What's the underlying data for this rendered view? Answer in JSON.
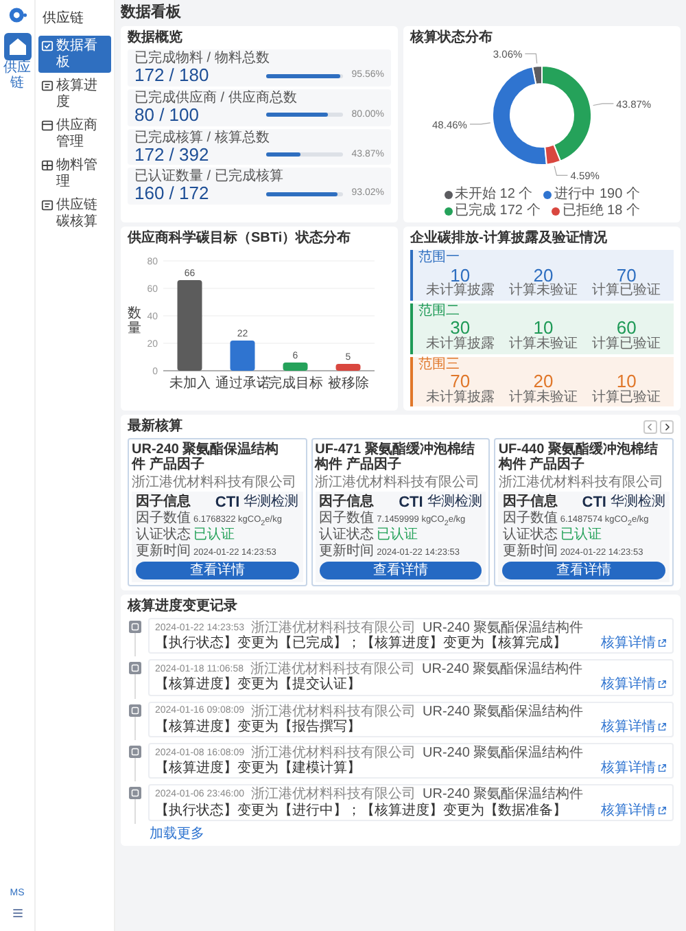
{
  "rail": {
    "items": [
      {
        "label": "供应链",
        "selected": true
      }
    ],
    "user_initials": "MS"
  },
  "sidebar": {
    "title": "供应链",
    "items": [
      {
        "label": "数据看板",
        "selected": true
      },
      {
        "label": "核算进度",
        "selected": false
      },
      {
        "label": "供应商管理",
        "selected": false
      },
      {
        "label": "物料管理",
        "selected": false
      },
      {
        "label": "供应链碳核算",
        "selected": false
      }
    ]
  },
  "page_title": "数据看板",
  "overview": {
    "title": "数据概览",
    "items": [
      {
        "label": "已完成物料 / 物料总数",
        "value": "172 / 180",
        "level": 0.9556,
        "percent": "95.56%"
      },
      {
        "label": "已完成供应商 / 供应商总数",
        "value": "80 / 100",
        "level": 0.8,
        "percent": "80.00%"
      },
      {
        "label": "已完成核算 / 核算总数",
        "value": "172 / 392",
        "level": 0.4387,
        "percent": "43.87%"
      },
      {
        "label": "已认证数量 / 已完成核算",
        "value": "160 / 172",
        "level": 0.9302,
        "percent": "93.02%"
      }
    ]
  },
  "status_chart": {
    "title": "核算状态分布",
    "chart_data": {
      "type": "donut",
      "categories": [
        "未开始",
        "进行中",
        "已完成",
        "已拒绝"
      ],
      "series": [
        {
          "values": [
            3.06,
            48.46,
            43.87,
            4.59
          ]
        }
      ],
      "value_labels": [
        "3.06%",
        "48.46%",
        "43.87%",
        "4.59%"
      ]
    },
    "legend": [
      {
        "count": "12 个",
        "color": "#5c5c60"
      },
      {
        "count": "190 个",
        "color": "#2f74d0"
      },
      {
        "count": "172 个",
        "color": "#25a25a"
      },
      {
        "count": "18 个",
        "color": "#d9473f"
      }
    ]
  },
  "sbti_chart": {
    "chart_data": {
      "type": "bar",
      "title": "供应商科学碳目标（SBTi）状态分布",
      "ylabel": "数量",
      "categories": [
        "未加入",
        "通过承诺",
        "完成目标",
        "被移除"
      ],
      "values": [
        66,
        22,
        6,
        5
      ],
      "ylim": [
        0,
        80
      ],
      "yticks": [
        0,
        20,
        40,
        60,
        80
      ],
      "grid": true,
      "data_labels": true
    },
    "bars": [
      {
        "color": "#5c5c5c"
      },
      {
        "color": "#2f74d0"
      },
      {
        "color": "#25a25a"
      },
      {
        "color": "#d9473f"
      }
    ]
  },
  "enterprise": {
    "title": "企业碳排放-计算披露及验证情况",
    "scopes": [
      {
        "label": "范围一",
        "color": "#2f6fc0",
        "metrics": [
          {
            "value": "10",
            "label": "未计算披露"
          },
          {
            "value": "20",
            "label": "计算未验证"
          },
          {
            "value": "70",
            "label": "计算已验证"
          }
        ]
      },
      {
        "label": "范围二",
        "color": "#1f9a57",
        "metrics": [
          {
            "value": "30",
            "label": "未计算披露"
          },
          {
            "value": "10",
            "label": "计算未验证"
          },
          {
            "value": "60",
            "label": "计算已验证"
          }
        ]
      },
      {
        "label": "范围三",
        "color": "#e0772a",
        "metrics": [
          {
            "value": "70",
            "label": "未计算披露"
          },
          {
            "value": "20",
            "label": "计算未验证"
          },
          {
            "value": "10",
            "label": "计算已验证"
          }
        ]
      }
    ]
  },
  "latest": {
    "title": "最新核算",
    "cards": [
      {
        "title": "UR-240 聚氨酯保温结构件 产品因子",
        "company": "浙江港优材料科技有限公司",
        "info_title": "因子信息",
        "rows": [
          {
            "label": "因子数值",
            "value": "6.1768322 kgCO$_{2}$e/kg",
            "kind": "plain"
          },
          {
            "label": "认证状态",
            "value": "已认证",
            "kind": "status"
          },
          {
            "label": "更新时间",
            "value": "2024-01-22 14:23:53",
            "kind": "plain"
          }
        ],
        "logo_text": "CTI",
        "logo_caption": "华测检测",
        "button": "查看详情"
      },
      {
        "title": "UF-471 聚氨酯缓冲泡棉结构件 产品因子",
        "company": "浙江港优材料科技有限公司",
        "info_title": "因子信息",
        "rows": [
          {
            "label": "因子数值",
            "value": "7.1459999 kgCO$_{2}$e/kg",
            "kind": "plain"
          },
          {
            "label": "认证状态",
            "value": "已认证",
            "kind": "status"
          },
          {
            "label": "更新时间",
            "value": "2024-01-22 14:23:53",
            "kind": "plain"
          }
        ],
        "logo_text": "CTI",
        "logo_caption": "华测检测",
        "button": "查看详情"
      },
      {
        "title": "UF-440 聚氨酯缓冲泡棉结构件 产品因子",
        "company": "浙江港优材料科技有限公司",
        "info_title": "因子信息",
        "rows": [
          {
            "label": "因子数值",
            "value": "6.1487574 kgCO$_{2}$e/kg",
            "kind": "plain"
          },
          {
            "label": "认证状态",
            "value": "已认证",
            "kind": "status"
          },
          {
            "label": "更新时间",
            "value": "2024-01-22 14:23:53",
            "kind": "plain"
          }
        ],
        "logo_text": "CTI",
        "logo_caption": "华测检测",
        "button": "查看详情"
      }
    ]
  },
  "timeline": {
    "title": "核算进度变更记录",
    "entries": [
      {
        "time": "2024-01-22 14:23:53",
        "company": "浙江港优材料科技有限公司",
        "product": "UR-240 聚氨酯保温结构件",
        "change": "【执行状态】变更为【已完成】；【核算进度】变更为【核算完成】",
        "link": "核算详情"
      },
      {
        "time": "2024-01-18 11:06:58",
        "company": "浙江港优材料科技有限公司",
        "product": "UR-240 聚氨酯保温结构件",
        "change": "【核算进度】变更为【提交认证】",
        "link": "核算详情"
      },
      {
        "time": "2024-01-16 09:08:09",
        "company": "浙江港优材料科技有限公司",
        "product": "UR-240 聚氨酯保温结构件",
        "change": "【核算进度】变更为【报告撰写】",
        "link": "核算详情"
      },
      {
        "time": "2024-01-08 16:08:09",
        "company": "浙江港优材料科技有限公司",
        "product": "UR-240 聚氨酯保温结构件",
        "change": "【核算进度】变更为【建模计算】",
        "link": "核算详情"
      },
      {
        "time": "2024-01-06 23:46:00",
        "company": "浙江港优材料科技有限公司",
        "product": "UR-240 聚氨酯保温结构件",
        "change": "【执行状态】变更为【进行中】；【核算进度】变更为【数据准备】",
        "link": "核算详情"
      }
    ],
    "load_more": "加载更多"
  }
}
